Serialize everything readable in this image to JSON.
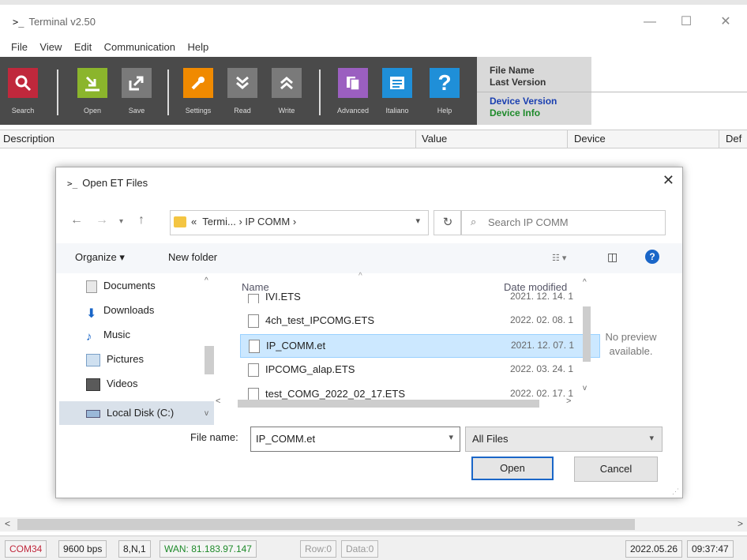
{
  "window": {
    "prompt": ">_",
    "title": "Terminal  v2.50"
  },
  "menu": [
    "File",
    "View",
    "Edit",
    "Communication",
    "Help"
  ],
  "toolbar": {
    "buttons": [
      {
        "label": "Search",
        "color": "#c0283c",
        "icon": "search-icon"
      },
      {
        "label": "Open",
        "color": "#8bb52c",
        "icon": "open-icon"
      },
      {
        "label": "Save",
        "color": "#7a7a7a",
        "icon": "save-icon"
      },
      {
        "label": "Settings",
        "color": "#f08a00",
        "icon": "wrench-icon"
      },
      {
        "label": "Read",
        "color": "#7a7a7a",
        "icon": "read-icon"
      },
      {
        "label": "Write",
        "color": "#7a7a7a",
        "icon": "write-icon"
      },
      {
        "label": "Advanced",
        "color": "#9b5fc0",
        "icon": "advanced-icon"
      },
      {
        "label": "Italiano",
        "color": "#1f8fd8",
        "icon": "language-icon"
      },
      {
        "label": "Help",
        "color": "#1f8fd8",
        "icon": "help-icon"
      }
    ],
    "file_name": "File Name",
    "last_version": "Last Version",
    "device_version": "Device Version",
    "device_info": "Device Info"
  },
  "columns": {
    "description": "Description",
    "value": "Value",
    "device": "Device",
    "default": "Def"
  },
  "dialog": {
    "prompt": ">_",
    "title": "Open ET Files",
    "address": {
      "prefix": "«",
      "path": "Termi...  ›  IP COMM  ›"
    },
    "search_placeholder": "Search IP COMM",
    "organize": "Organize ▾",
    "new_folder": "New folder",
    "nav_items": [
      "Documents",
      "Downloads",
      "Music",
      "Pictures",
      "Videos",
      "Local Disk (C:)"
    ],
    "header_name": "Name",
    "header_date": "Date modified",
    "files": [
      {
        "name": "IVI.ETS",
        "date": "2021. 12. 14. 1"
      },
      {
        "name": "4ch_test_IPCOMG.ETS",
        "date": "2022. 02. 08. 1"
      },
      {
        "name": "IP_COMM.et",
        "date": "2021. 12. 07. 1"
      },
      {
        "name": "IPCOMG_alap.ETS",
        "date": "2022. 03. 24. 1"
      },
      {
        "name": "test_COMG_2022_02_17.ETS",
        "date": "2022. 02. 17. 1"
      }
    ],
    "preview": "No preview\navailable.",
    "file_name_label": "File name:",
    "file_name_value": "IP_COMM.et",
    "file_type": "All Files",
    "open_label": "Open",
    "cancel_label": "Cancel"
  },
  "status": {
    "port": "COM34",
    "baud": "9600 bps",
    "frame": "8,N,1",
    "wan": "WAN: 81.183.97.147",
    "row": "Row:0",
    "data": "Data:0",
    "date": "2022.05.26",
    "time": "09:37:47"
  },
  "colors": {
    "toolbar_bg": "#4a4a4a",
    "device_version": "#1a3fb0",
    "device_info": "#1e8a2a",
    "port": "#c0283c",
    "wan": "#1e8a2a",
    "selection": "#cce8ff"
  }
}
